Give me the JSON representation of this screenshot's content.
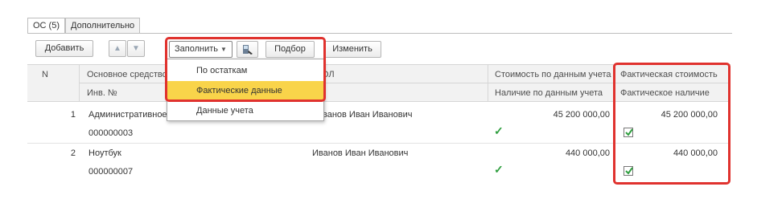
{
  "tabs": [
    {
      "label": "ОС (5)"
    },
    {
      "label": "Дополнительно"
    }
  ],
  "toolbar": {
    "add_label": "Добавить",
    "up_icon": "arrow-up-icon",
    "down_icon": "arrow-down-icon",
    "fill_label": "Заполнить",
    "barcode_icon": "barcode-scanner-icon",
    "select_label": "Подбор",
    "edit_label": "Изменить"
  },
  "fill_menu": {
    "items": [
      {
        "label": "По остаткам"
      },
      {
        "label": "Фактические данные"
      },
      {
        "label": "Данные учета"
      }
    ]
  },
  "table": {
    "headers": {
      "n": "N",
      "asset": "Основное средство",
      "inv": "Инв. №",
      "mol": "ОЛ",
      "cost_acc": "Стоимость по данным учета",
      "presence_acc": "Наличие по данным учета",
      "cost_fact": "Фактическая стоимость",
      "presence_fact": "Фактическое наличие"
    },
    "rows": [
      {
        "n": "1",
        "asset": "Административное",
        "inv": "000000003",
        "mol": "ванов Иван Иванович",
        "cost_acc": "45 200 000,00",
        "presence_acc": true,
        "cost_fact": "45 200 000,00",
        "presence_fact": true
      },
      {
        "n": "2",
        "asset": "Ноутбук",
        "inv": "000000007",
        "mol": "Иванов Иван Иванович",
        "cost_acc": "440 000,00",
        "presence_acc": true,
        "cost_fact": "440 000,00",
        "presence_fact": true
      }
    ]
  },
  "colors": {
    "highlight": "#f9d44a",
    "annotation": "#e0322e",
    "check": "#2e9e3e"
  }
}
